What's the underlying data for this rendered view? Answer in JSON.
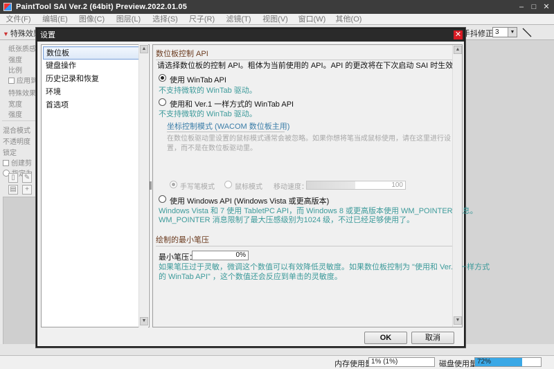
{
  "app": {
    "title": "PaintTool SAI Ver.2 (64bit) Preview.2022.01.05",
    "window_buttons": [
      "–",
      "□",
      "✕"
    ]
  },
  "menu": [
    "文件(F)",
    "编辑(E)",
    "图像(C)",
    "图层(L)",
    "选择(S)",
    "尺子(R)",
    "滤镜(T)",
    "视图(V)",
    "窗口(W)",
    "其他(O)"
  ],
  "toolbar": {
    "effect_label": "特殊效果",
    "stabilizer_label": "手抖修正",
    "stabilizer_value": "3"
  },
  "left_panel": {
    "rows": [
      "纸张质感",
      "强度",
      "比例",
      "应用到",
      "特殊效果",
      "宽度",
      "强度",
      "混合模式",
      "不透明度",
      "锁定",
      "创建剪",
      "指定为"
    ]
  },
  "status": {
    "memory_label": "内存使用量",
    "memory_value": "1% (1%)",
    "disk_label": "磁盘使用量",
    "disk_value": "72%",
    "disk_fraction": 0.72
  },
  "dialog": {
    "title": "设置",
    "close": "✕",
    "nav": [
      "数位板",
      "键盘操作",
      "历史记录和恢复",
      "环境",
      "首选项"
    ],
    "active_nav": 0,
    "section_api": "数位板控制 API",
    "api_intro": "请选择数位板的控制 API。粗体为当前使用的 API。API 的更改将在下次启动 SAI 时生效。",
    "option1": "使用 WinTab API",
    "option1_note": "不支持微软的 WinTab 驱动。",
    "option2": "使用和 Ver.1 一样方式的 WinTab API",
    "option2_note": "不支持微软的 WinTab 驱动。",
    "coord_mode_title": "坐标控制模式 (WACOM 数位板主用)",
    "coord_desc_1": "在数位板驱动里设置的鼠标模式通常会被忽略。如果你想将笔当成鼠标使用，请在这里进行设",
    "coord_desc_2": "置，而不是在数位板驱动里。",
    "pen_mode": "手写笔模式",
    "mouse_mode": "鼠标模式",
    "speed_label": "移动速度：",
    "speed_value": "100",
    "option3": "使用 Windows API (Windows Vista 或更高版本)",
    "option3_note_1": "Windows Vista 和 7 使用 TabletPC API，而 Windows 8 或更高版本使用 WM_POINTER 消息。",
    "option3_note_2": "WM_POINTER 消息限制了最大压感级别为1024 级，不过已经足够使用了。",
    "section_pressure": "绘制的最小笔压",
    "min_pressure_label": "最小笔压：",
    "min_pressure_value": "0%",
    "pressure_note_1": "如果笔压过于灵敏，微调这个数值可以有效降低灵敏度。如果数位板控制为 \"使用和 Ver.1 一样方式",
    "pressure_note_2": "的 WinTab API\" ，这个数值还会反应到单击的灵敏度。",
    "ok": "OK",
    "cancel": "取消"
  }
}
